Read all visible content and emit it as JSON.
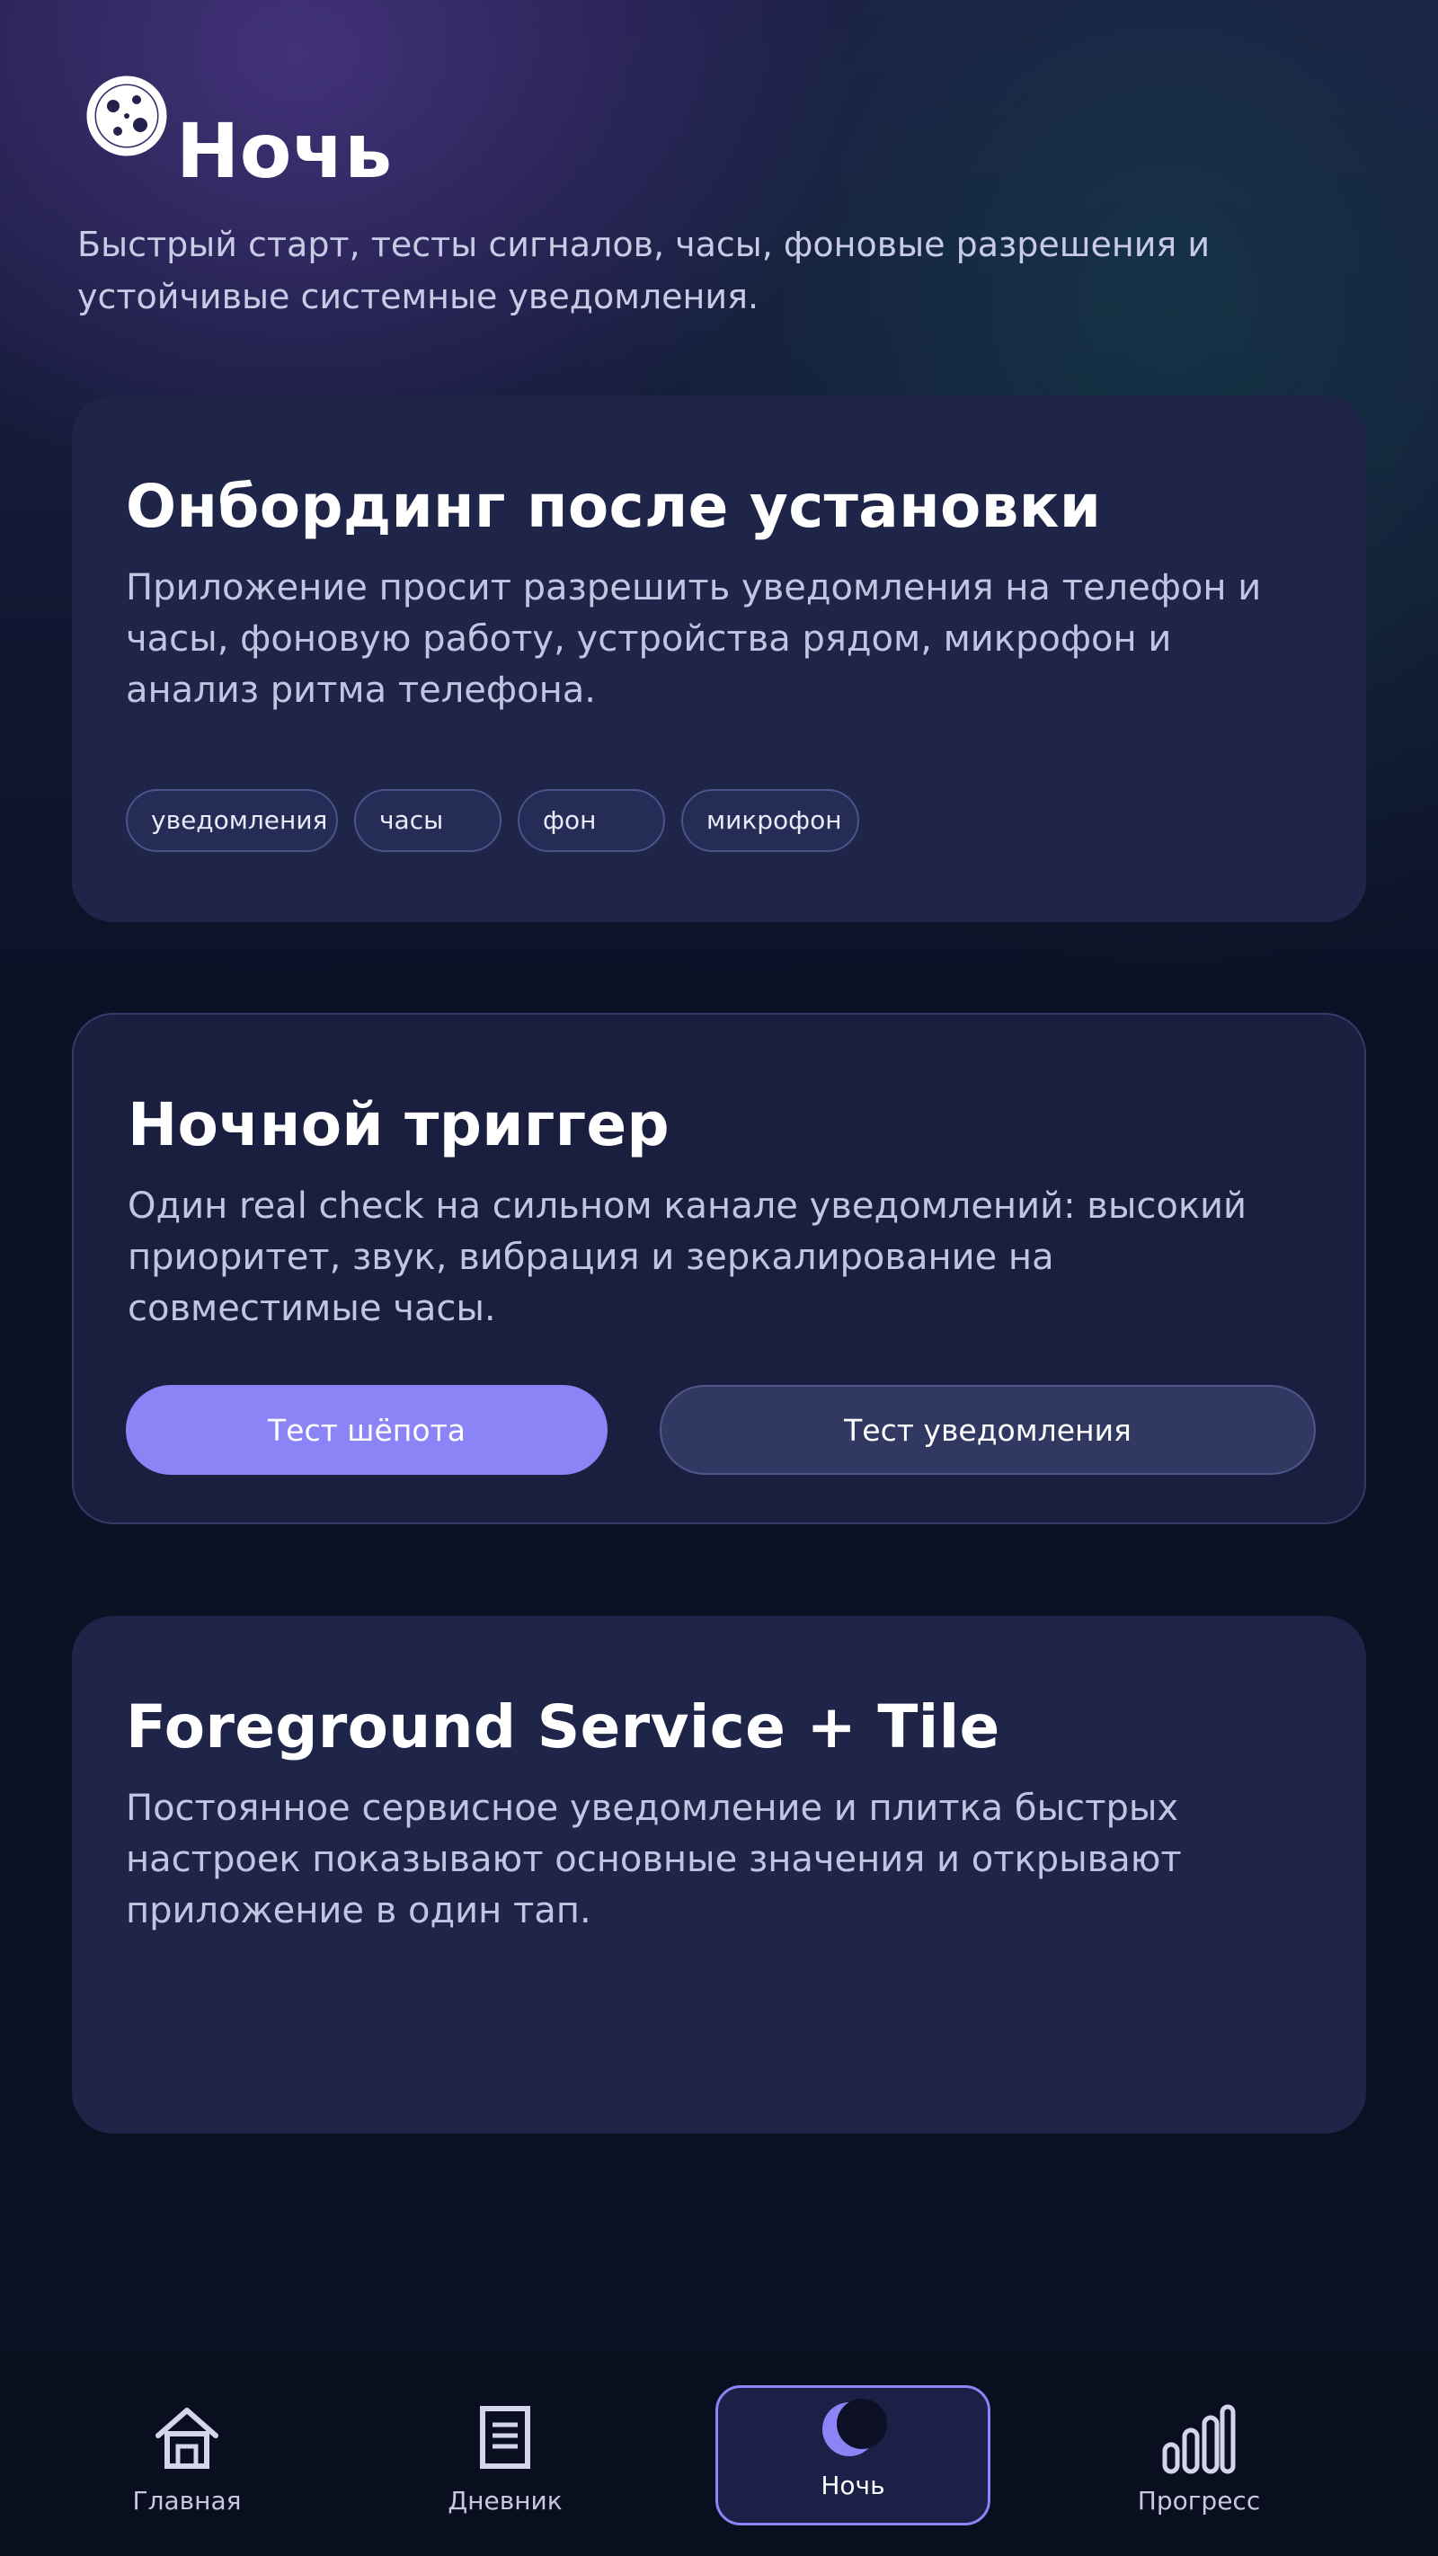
{
  "header": {
    "title": "Ночь",
    "subtitle": "Быстрый старт, тесты сигналов, часы, фоновые разрешения и устойчивые системные уведомления.",
    "logo_icon": "moon-icon"
  },
  "cards": {
    "onboarding": {
      "title": "Онбординг после установки",
      "text": "Приложение просит разрешить уведомления на телефон и часы, фоновую работу, устройства рядом, микрофон и анализ ритма телефона.",
      "chips": [
        "уведомления",
        "часы",
        "фон",
        "микрофон"
      ]
    },
    "night_trigger": {
      "title": "Ночной триггер",
      "text": "Один real check на сильном канале уведомлений: высокий приоритет, звук, вибрация и зеркалирование на совместимые часы.",
      "primary_button": "Тест шёпота",
      "secondary_button": "Тест уведомления"
    },
    "foreground": {
      "title": "Foreground Service + Tile",
      "text": "Постоянное сервисное уведомление и плитка быстрых настроек показывают основные значения и открывают приложение в один тап."
    }
  },
  "nav": {
    "items": [
      {
        "label": "Главная",
        "icon": "home-icon",
        "active": false
      },
      {
        "label": "Дневник",
        "icon": "diary-icon",
        "active": false
      },
      {
        "label": "Ночь",
        "icon": "moon-icon",
        "active": true
      },
      {
        "label": "Прогресс",
        "icon": "bar-chart-icon",
        "active": false
      }
    ]
  },
  "colors": {
    "accent": "#8b84f7",
    "card": "#1f2548",
    "background": "#0b1020"
  }
}
